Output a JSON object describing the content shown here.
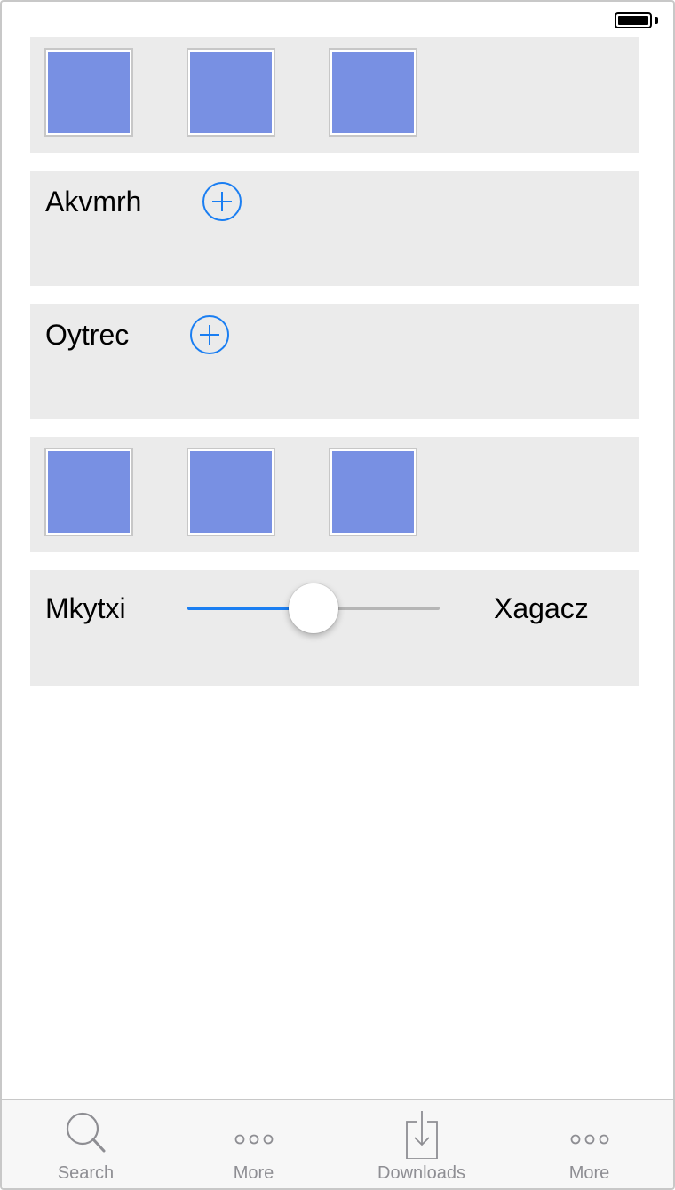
{
  "colors": {
    "accent": "#1a7ef2",
    "tile_fill": "#7890e3",
    "panel_bg": "#ebebeb",
    "tab_inactive": "#8e8e93"
  },
  "panels": {
    "row1": {
      "label": "Akvmrh",
      "icon": "plus-circle-icon"
    },
    "row2": {
      "label": "Oytrec",
      "icon": "plus-circle-icon"
    },
    "slider": {
      "min_label": "Mkytxi",
      "max_label": "Xagacz",
      "value_fraction": 0.5
    }
  },
  "tab_bar": {
    "tabs": [
      {
        "label": "Search",
        "icon": "search-icon"
      },
      {
        "label": "More",
        "icon": "more-icon"
      },
      {
        "label": "Downloads",
        "icon": "downloads-icon"
      },
      {
        "label": "More",
        "icon": "more-icon"
      }
    ]
  }
}
